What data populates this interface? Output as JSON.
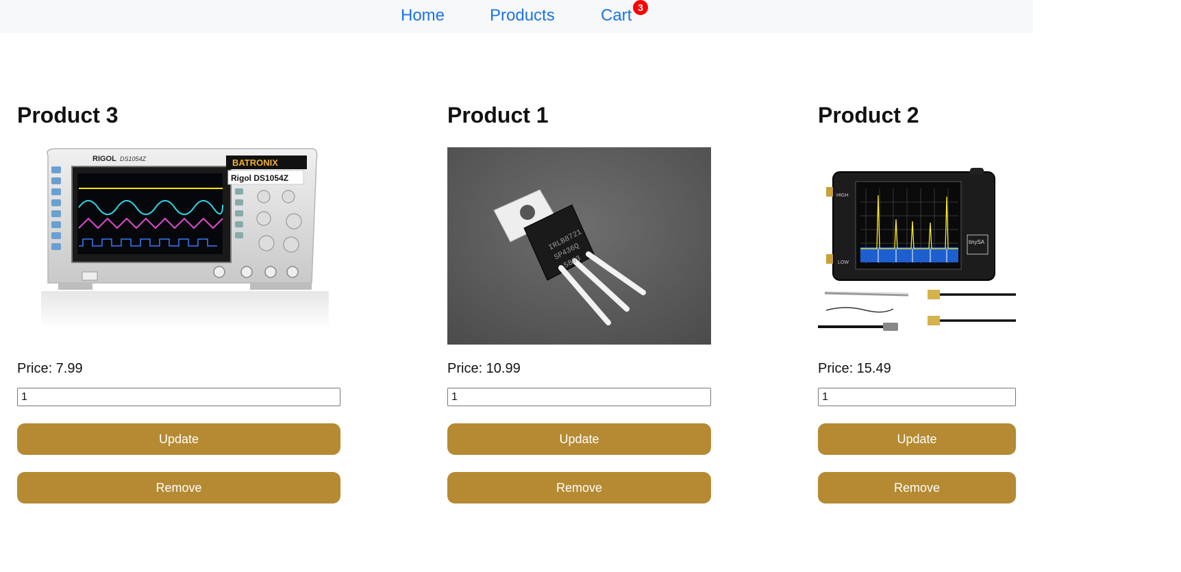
{
  "nav": {
    "home": "Home",
    "products": "Products",
    "cart": "Cart",
    "cart_count": "3"
  },
  "products": [
    {
      "name": "Product 3",
      "price_label": "Price: 7.99",
      "quantity": "1",
      "update_label": "Update",
      "remove_label": "Remove",
      "image_brand": "RIGOL",
      "image_model": "DS1054Z",
      "image_vendor": "BATRONIX",
      "image_caption": "Rigol DS1054Z"
    },
    {
      "name": "Product 1",
      "price_label": "Price: 10.99",
      "quantity": "1",
      "update_label": "Update",
      "remove_label": "Remove",
      "image_marking_1": "IRLB8721",
      "image_marking_2": "SP436Q",
      "image_marking_3": "5863"
    },
    {
      "name": "Product 2",
      "price_label": "Price: 15.49",
      "quantity": "1",
      "update_label": "Update",
      "remove_label": "Remove",
      "image_brand": "tinySA",
      "image_port_high": "HIGH",
      "image_port_low": "LOW"
    }
  ],
  "colors": {
    "accent": "#b58a33",
    "link": "#1a73e8",
    "badge": "#ff0000"
  }
}
